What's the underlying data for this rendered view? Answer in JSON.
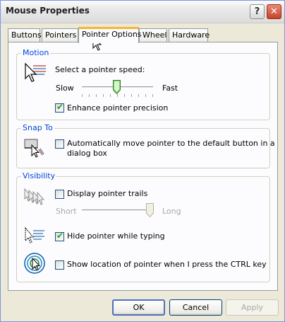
{
  "window": {
    "title": "Mouse Properties",
    "help_glyph": "?",
    "close_glyph": "✕"
  },
  "tabs": [
    {
      "label": "Buttons",
      "active": false
    },
    {
      "label": "Pointers",
      "active": false
    },
    {
      "label": "Pointer Options",
      "active": true
    },
    {
      "label": "Wheel",
      "active": false
    },
    {
      "label": "Hardware",
      "active": false
    }
  ],
  "motion": {
    "group_label": "Motion",
    "speed_label": "Select a pointer speed:",
    "slow_label": "Slow",
    "fast_label": "Fast",
    "speed_value_fraction": 0.5,
    "enhance_label": "Enhance pointer precision",
    "enhance_checked": true
  },
  "snap_to": {
    "group_label": "Snap To",
    "auto_label_line1": "Automatically move pointer to the default button in a",
    "auto_label_line2": "dialog box",
    "auto_checked": false
  },
  "visibility": {
    "group_label": "Visibility",
    "trails_label": "Display pointer trails",
    "trails_checked": false,
    "short_label": "Short",
    "long_label": "Long",
    "trail_length_fraction": 1.0,
    "hide_label": "Hide pointer while typing",
    "hide_checked": true,
    "show_location_label": "Show location of pointer when I press the CTRL key",
    "show_location_checked": false
  },
  "buttons": {
    "ok": "OK",
    "cancel": "Cancel",
    "apply": "Apply"
  },
  "colors": {
    "group_label": "#0046d5",
    "check_mark": "#21a121",
    "active_tab_highlight": "#f7b43b",
    "close_button": "#c6432a"
  },
  "icons": {
    "motion": "pointer-speed-icon",
    "snap": "snap-to-button-icon",
    "trails": "pointer-trails-icon",
    "hide": "hide-pointer-icon",
    "location": "pointer-location-icon"
  }
}
